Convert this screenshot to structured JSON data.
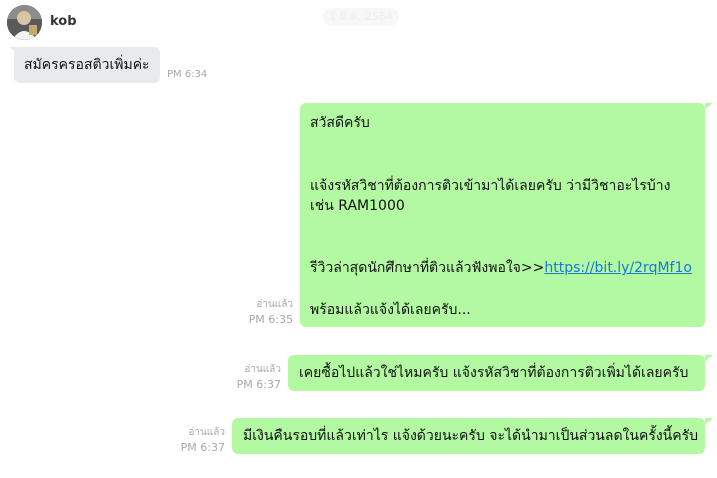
{
  "header": {
    "date_pill": "1 มี.ค. 2564"
  },
  "contact": {
    "name": "kob"
  },
  "messages": [
    {
      "direction": "incoming",
      "text": "สมัครครอสติวเพิ่มค่ะ",
      "time": "PM 6:34"
    },
    {
      "direction": "outgoing",
      "lines": [
        "สวัสดีครับ",
        "แจ้งรหัสวิชาที่ต้องการติวเข้ามาได้เลยครับ ว่ามีวิชาอะไรบ้าง",
        "เช่น RAM1000",
        "รีวิวล่าสุดนักศึกษาที่ติวแล้วฟังพอใจ>>",
        "พร้อมแล้วแจ้งได้เลยครับ..."
      ],
      "link": "https://bit.ly/2rqMf1o",
      "read_label": "อ่านแล้ว",
      "time": "PM 6:35"
    },
    {
      "direction": "outgoing",
      "text": "เคยซื้อไปแล้วใช่ไหมครับ แจ้งรหัสวิชาที่ต้องการติวเพิ่มได้เลยครับ",
      "read_label": "อ่านแล้ว",
      "time": "PM 6:37"
    },
    {
      "direction": "outgoing",
      "text": "มีเงินคืนรอบที่แล้วเท่าไร แจ้งด้วยนะครับ จะได้นำมาเป็นส่วนลดในครั้งนี้ครับ",
      "read_label": "อ่านแล้ว",
      "time": "PM 6:37"
    }
  ],
  "colors": {
    "incoming_bubble": "#e9eaee",
    "outgoing_bubble": "#b2f9a1",
    "link": "#1a78d8",
    "meta_text": "#a8a8a8"
  }
}
